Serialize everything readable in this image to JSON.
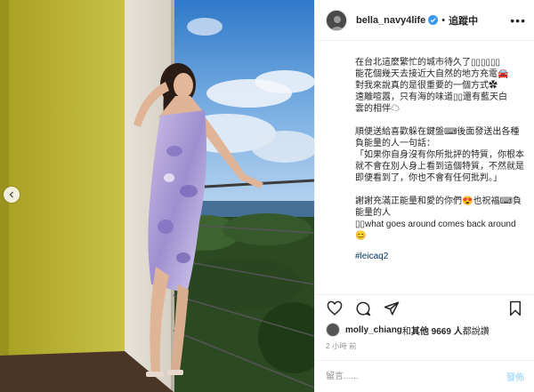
{
  "header": {
    "username": "bella_navy4life",
    "separator": "•",
    "follow_label": "追蹤中",
    "more_icon": "more-horizontal-icon"
  },
  "caption": {
    "lines": [
      "在台北這麼繁忙的城市待久了▯▯▯▯▯▯",
      "能花個幾天去接近大自然的地方充電🚘",
      "對我來說真的是很重要的一個方式✿",
      "遠離喧囂，只有海的味道▯▯還有藍天白",
      "雲的相伴☁"
    ],
    "para2": "順便送給喜歡躲在鍵盤⌨後面發送出各種負能量的人一句話：",
    "quote": "「如果你自身沒有你所批評的特質，你根本就不會在別人身上看到這個特質，不然就是即便看到了，你也不會有任何批判。」",
    "para3_line1": "謝謝充滿正能量和愛的你們😍也祝福⌨負能量的人",
    "para3_line2": "▯▯what goes around comes back around😊",
    "hashtag": "#leicaq2"
  },
  "likes": {
    "liker": "molly_chiang",
    "connector": " 和 ",
    "others": "其他 9669 人",
    "suffix": " 都說讚"
  },
  "timestamp": "2 小時 前",
  "comment": {
    "placeholder": "留言......",
    "post_label": "發佈"
  },
  "colors": {
    "link": "#00376b",
    "post_disabled": "#b2dffc",
    "verified": "#3897f0",
    "border": "#efefef"
  }
}
